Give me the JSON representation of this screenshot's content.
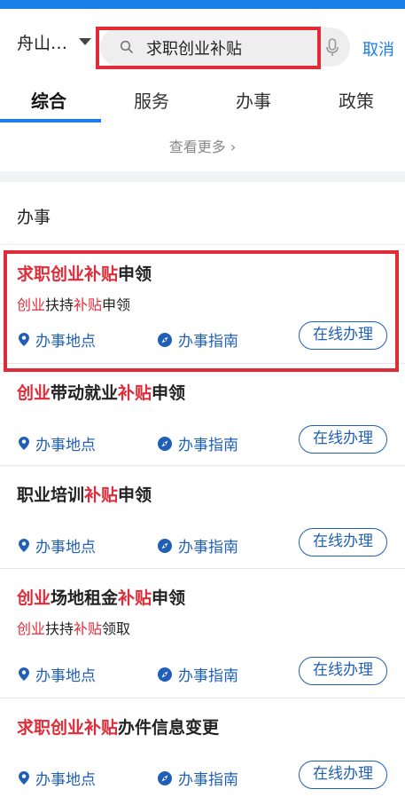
{
  "header": {
    "city": "舟山…",
    "search_query": "求职创业补贴",
    "cancel_label": "取消"
  },
  "tabs": [
    {
      "label": "综合",
      "active": true
    },
    {
      "label": "服务",
      "active": false
    },
    {
      "label": "办事",
      "active": false
    },
    {
      "label": "政策",
      "active": false
    }
  ],
  "more_label": "查看更多 ›",
  "section_title": "办事",
  "actions": {
    "location_label": "办事地点",
    "guide_label": "办事指南",
    "online_label": "在线办理"
  },
  "items": [
    {
      "title": [
        {
          "t": "求职创业补贴",
          "hl": true
        },
        {
          "t": "申领",
          "hl": false
        }
      ],
      "subtitle": [
        {
          "t": "创业",
          "hl": true
        },
        {
          "t": "扶持",
          "hl": false
        },
        {
          "t": "补贴",
          "hl": true
        },
        {
          "t": "申领",
          "hl": false
        }
      ]
    },
    {
      "title": [
        {
          "t": "创业",
          "hl": true
        },
        {
          "t": "带动就业",
          "hl": false
        },
        {
          "t": "补贴",
          "hl": true
        },
        {
          "t": "申领",
          "hl": false
        }
      ],
      "subtitle": []
    },
    {
      "title": [
        {
          "t": "职业培训",
          "hl": false
        },
        {
          "t": "补贴",
          "hl": true
        },
        {
          "t": "申领",
          "hl": false
        }
      ],
      "subtitle": []
    },
    {
      "title": [
        {
          "t": "创业",
          "hl": true
        },
        {
          "t": "场地租金",
          "hl": false
        },
        {
          "t": "补贴",
          "hl": true
        },
        {
          "t": "申领",
          "hl": false
        }
      ],
      "subtitle": [
        {
          "t": "创业",
          "hl": true
        },
        {
          "t": "扶持",
          "hl": false
        },
        {
          "t": "补贴",
          "hl": true
        },
        {
          "t": "领取",
          "hl": false
        }
      ]
    },
    {
      "title": [
        {
          "t": "求职创业补贴",
          "hl": true
        },
        {
          "t": "办件信息变更",
          "hl": false
        }
      ],
      "subtitle": []
    }
  ],
  "colors": {
    "accent": "#1a7ee8",
    "highlight": "#e02b38",
    "action": "#1f5fb8"
  },
  "icons": [
    "search-icon",
    "microphone-icon",
    "location-pin-icon",
    "compass-icon",
    "chevron-down-icon"
  ]
}
